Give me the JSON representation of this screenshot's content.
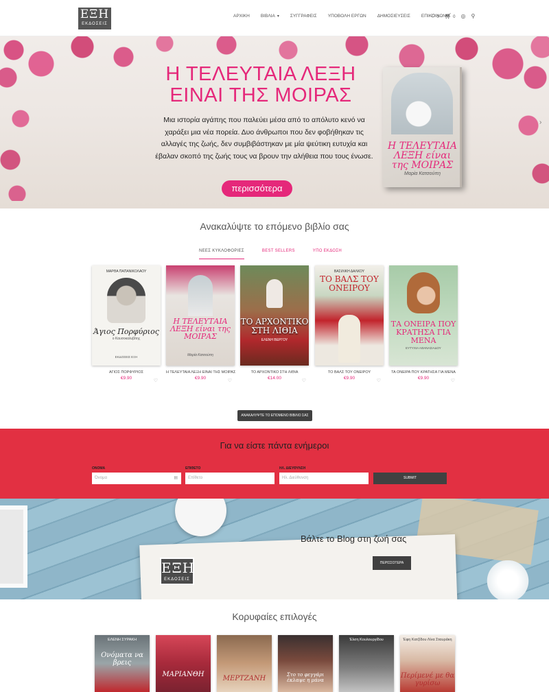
{
  "logo": {
    "big": "ΕΞΗ",
    "small": "ΕΚΔΟΣΕΙΣ"
  },
  "nav": {
    "items": [
      "ΑΡΧΙΚΗ",
      "ΒΙΒΛΙΑ",
      "ΣΥΓΓΡΑΦΕΙΣ",
      "ΥΠΟΒΟΛΗ ΕΡΓΩΝ",
      "ΔΗΜΟΣΙΕΥΣΕΙΣ",
      "ΕΠΙΚΟΙΝΩΝΙΑ"
    ],
    "wishlist_count": "0",
    "cart_count": "0"
  },
  "hero": {
    "title_line1": "Η ΤΕΛΕΥΤΑΙΑ ΛΕΞΗ",
    "title_line2": "ΕΙΝΑΙ ΤΗΣ ΜΟΙΡΑΣ",
    "text": "Μια ιστορία αγάπης που παλεύει μέσα από το απόλυτο κενό να χαράξει μια νέα πορεία. Δυο άνθρωποι που δεν φοβήθηκαν τις αλλαγές της ζωής, δεν συμβιβάστηκαν με μία ψεύτικη ευτυχία και έβαλαν σκοπό της ζωής τους να βρουν την αλήθεια που τους ένωσε.",
    "button": "περισσότερα",
    "book_title": "Η ΤΕΛΕΥΤΑΙΑ ΛΕΞΗ είναι της ΜΟΙΡΑΣ",
    "book_author": "Μαρία Κατσούπη"
  },
  "discover": {
    "title": "Ανακαλύψτε το επόμενο βιβλίο σας",
    "tabs": [
      "ΝΕΕΣ ΚΥΚΛΟΦΟΡΙΕΣ",
      "BEST SELLERS",
      "ΥΠΟ ΕΚΔΟΣΗ"
    ],
    "books": [
      {
        "name": "ΑΓΙΟΣ ΠΟΡΦΥΡΙΟΣ",
        "price": "€9.90",
        "cover_title": "Άγιος Πορφύριος",
        "cover_author": "ΜΑΡΘΑ ΠΑΠΑΝΙΚΟΛΑΟΥ",
        "cover_sub": "ο Καυσοκαλυβίτης",
        "cover_pub": "ΕΚΔΟΣΕΙΣ ΕΞΗ"
      },
      {
        "name": "Η ΤΕΛΕΥΤΑΙΑ ΛΕΞΗ ΕΙΝΑΙ ΤΗΣ ΜΟΙΡΑΣ",
        "price": "€9.90",
        "cover_title": "Η ΤΕΛΕΥΤΑΙΑ ΛΕΞΗ είναι της ΜΟΙΡΑΣ",
        "cover_author": "Μαρία Κατσούπη"
      },
      {
        "name": "ΤΟ ΑΡΧΟΝΤΙΚΟ ΣΤΗ ΛΙΘΙΑ",
        "price": "€14.00",
        "cover_title": "ΤΟ ΑΡΧΟΝΤΙΚΟ ΣΤΗ ΛΙΘΙΑ",
        "cover_author": "ΕΛΕΝΗ ΒΕΡΓΟΥ"
      },
      {
        "name": "ΤΟ ΒΑΛΣ ΤΟΥ ΟΝΕΙΡΟΥ",
        "price": "€9.90",
        "cover_title": "ΤΟ ΒΑΛΣ ΤΟΥ ΟΝΕΙΡΟΥ",
        "cover_author": "ΒΑΣΙΛΙΚΗ ΔΑΛΚΟΥ"
      },
      {
        "name": "ΤΑ ΟΝΕΙΡΑ ΠΟΥ ΚΡΑΤΗΣΑ ΓΙΑ ΜΕΝΑ",
        "price": "€9.90",
        "cover_title": "ΤΑ ΟΝΕΙΡΑ ΠΟΥ ΚΡΑΤΗΣΑ ΓΙΑ ΜΕΝΑ",
        "cover_author": "ΕΥΤΥΧΙΑ ΑΘΑΝΑΣΙΑΔΟΥ"
      }
    ],
    "button": "ΑΝΑΚΑΛΥΨΤΕ ΤΟ ΕΠΟΜΕΝΟ ΒΙΒΛΙΟ ΣΑΣ"
  },
  "newsletter": {
    "title": "Για να είστε πάντα ενήμεροι",
    "name_label": "ΟΝΟΜΑ",
    "name_placeholder": "Όνομα",
    "surname_label": "ΕΠΙΘΕΤΟ",
    "surname_placeholder": "Επίθετο",
    "email_label": "ΗΛ. ΔΙΕΥΘΥΝΣΗ",
    "email_placeholder": "Ηλ. Διεύθυνση",
    "submit": "SUBMIT"
  },
  "blog": {
    "title": "Βάλτε το Blog στη ζωή σας",
    "button": "ΠΕΡΙΣΣΟΤΕΡΑ",
    "logo_big": "ΕΞΗ",
    "logo_small": "ΕΚΔΟΣΕΙΣ"
  },
  "top_picks": {
    "title": "Κορυφαίες επιλογές",
    "books": [
      {
        "author": "ΕΛΕΝΗ ΣΥΡΑΚΗ",
        "title": "Ονόματα να βρεις"
      },
      {
        "author": "",
        "title": "ΜΑΡΙΑΝΘΗ"
      },
      {
        "author": "",
        "title": "ΜΕΡΤΖΑΝΗ"
      },
      {
        "author": "",
        "title": "Στο το φεγγάρι έκλαψε η μάνα"
      },
      {
        "author": "Έλση Κουλουργίδου",
        "title": ""
      },
      {
        "author": "Έφη Κατζίδου Λίνα Σταυράκη",
        "title": "Περίμενέ με θα γυρίσω"
      }
    ]
  },
  "colors": {
    "accent": "#e5287a",
    "newsletter_bg": "#e23042",
    "dark_button": "#404040"
  }
}
